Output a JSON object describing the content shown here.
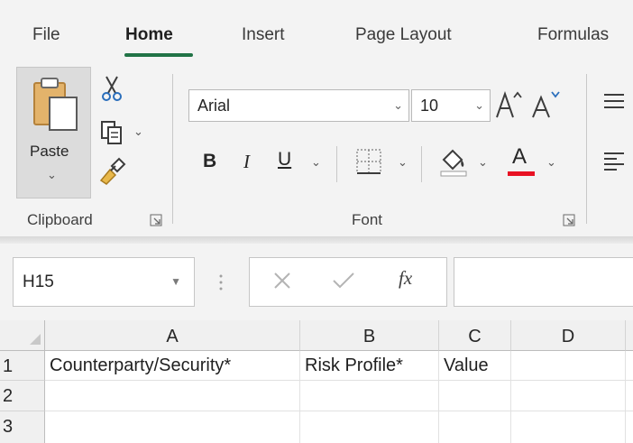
{
  "tabs": [
    {
      "label": "File"
    },
    {
      "label": "Home"
    },
    {
      "label": "Insert"
    },
    {
      "label": "Page Layout"
    },
    {
      "label": "Formulas"
    }
  ],
  "active_tab": "Home",
  "clipboard": {
    "paste_label": "Paste",
    "group_label": "Clipboard"
  },
  "font": {
    "group_label": "Font",
    "font_name": "Arial",
    "font_size": "10",
    "bold_label": "B",
    "italic_label": "I",
    "underline_label": "U",
    "font_color_label": "A"
  },
  "colors": {
    "accent": "#217346",
    "font_color_bar": "#e81123"
  },
  "name_box": {
    "value": "H15"
  },
  "formula_bar": {
    "fx_label": "fx"
  },
  "sheet": {
    "columns": [
      "A",
      "B",
      "C",
      "D"
    ],
    "rows": [
      "1",
      "2",
      "3"
    ],
    "cells": {
      "A1": "Counterparty/Security*",
      "B1": "Risk Profile*",
      "C1": "Value"
    }
  }
}
